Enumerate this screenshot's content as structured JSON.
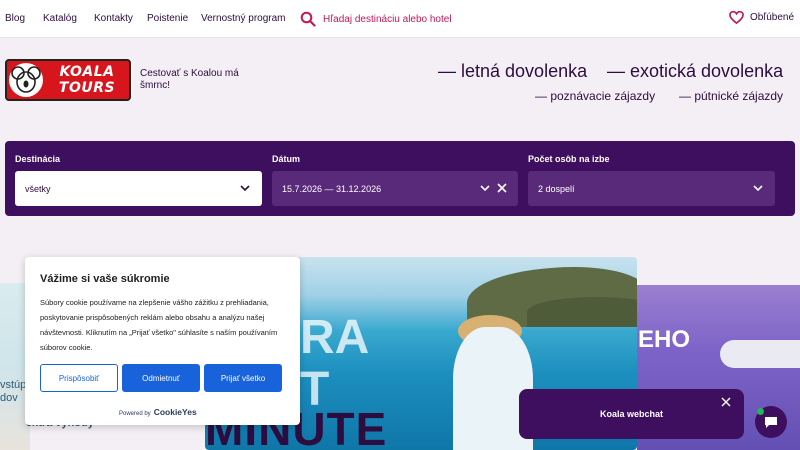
{
  "topnav": {
    "links": [
      "Blog",
      "Katalóg",
      "Kontakty",
      "Poistenie",
      "Vernostný program"
    ],
    "search_placeholder": "Hľadaj destináciu alebo hotel",
    "favorites_label": "Obľúbené"
  },
  "header": {
    "logo_text": "KOALA TOURS",
    "tagline": "Cestovať s Koalou má šmrnc!",
    "categories_main": [
      "— letná dovolenka",
      "— exotická dovolenka"
    ],
    "categories_secondary": [
      "— poznávacie zájazdy",
      "— pútnické zájazdy"
    ]
  },
  "search": {
    "destination_label": "Destinácia",
    "destination_value": "všetky",
    "date_label": "Dátum",
    "date_value": "15.7.2026 — 31.12.2026",
    "persons_label": "Počet osôb na izbe",
    "persons_value": "2 dospelí"
  },
  "hero": {
    "left_text_line1": "vstúp",
    "left_text_line2": "dov",
    "left_text_line3": "extra výhody",
    "main_overlay": "RA\nT",
    "main_minute": "MINUTE",
    "right_text": "EHO"
  },
  "cookie": {
    "title": "Vážime si vaše súkromie",
    "body": "Súbory cookie používame na zlepšenie vášho zážitku z prehliadania, poskytovanie prispôsobených reklám alebo obsahu a analýzu našej návštevnosti. Kliknutím na „Prijať všetko\" súhlasíte s naším používaním súborov cookie.",
    "customize": "Prispôsobiť",
    "reject": "Odmietnuť",
    "accept": "Prijať všetko",
    "powered_by": "Powered by",
    "brand": "CookieYes"
  },
  "webchat": {
    "label": "Koala webchat"
  },
  "colors": {
    "brand_purple": "#3e0f5e",
    "accent_red": "#c2185b",
    "cookie_blue": "#1863dc"
  }
}
